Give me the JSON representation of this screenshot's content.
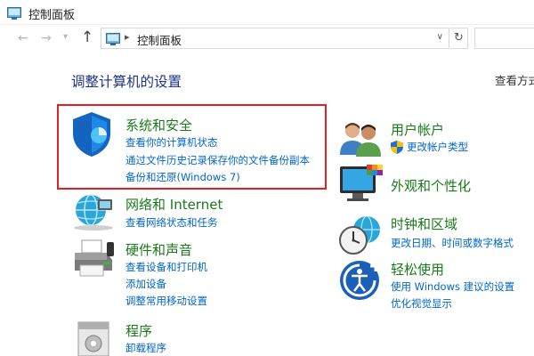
{
  "window": {
    "title": "控制面板"
  },
  "address": {
    "crumb": "控制面板",
    "separator": "▸"
  },
  "main": {
    "heading": "调整计算机的设置",
    "view_by": "查看方式"
  },
  "left_categories": [
    {
      "title": "系统和安全",
      "icon": "shield-icon",
      "links": [
        "查看你的计算机状态",
        "通过文件历史记录保存你的文件备份副本",
        "备份和还原(Windows 7)"
      ]
    },
    {
      "title": "网络和 Internet",
      "icon": "network-globe-icon",
      "links": [
        "查看网络状态和任务"
      ]
    },
    {
      "title": "硬件和声音",
      "icon": "printer-icon",
      "links": [
        "查看设备和打印机",
        "添加设备",
        "调整常用移动设置"
      ]
    },
    {
      "title": "程序",
      "icon": "programs-icon",
      "links": [
        "卸载程序"
      ]
    }
  ],
  "right_categories": [
    {
      "title": "用户帐户",
      "icon": "users-icon",
      "links": [
        "更改帐户类型"
      ]
    },
    {
      "title": "外观和个性化",
      "icon": "monitor-palette-icon",
      "links": []
    },
    {
      "title": "时钟和区域",
      "icon": "clock-globe-icon",
      "links": [
        "更改日期、时间或数字格式"
      ]
    },
    {
      "title": "轻松使用",
      "icon": "ease-of-access-icon",
      "links": [
        "使用 Windows 建议的设置",
        "优化视觉显示"
      ]
    }
  ],
  "colors": {
    "link": "#0066cc",
    "category_title": "#1a7a1a",
    "heading": "#1e3287",
    "highlight_border": "#e81c23"
  }
}
